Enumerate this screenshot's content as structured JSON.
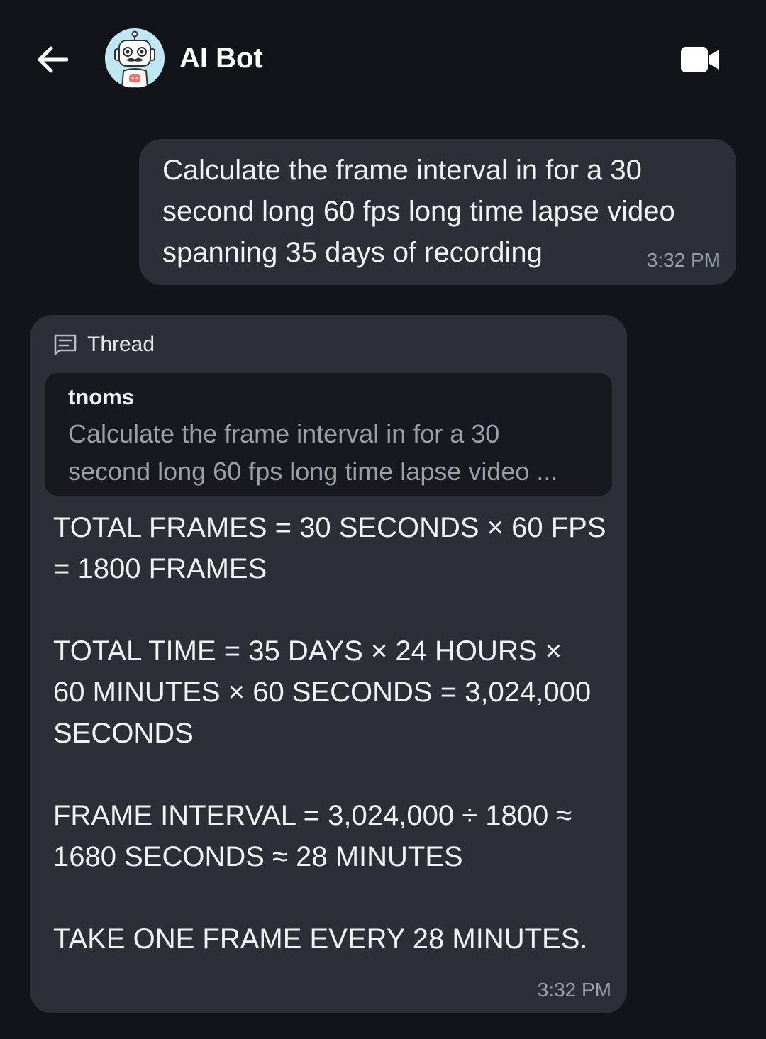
{
  "header": {
    "title": "AI Bot",
    "back_icon": "arrow-left-icon",
    "video_icon": "video-camera-icon"
  },
  "messages": {
    "user": {
      "text": "Calculate the frame interval in for a 30\nsecond long 60 fps long time lapse video\nspanning 35 days of recording",
      "time": "3:32 PM"
    },
    "bot": {
      "thread_label": "Thread",
      "quote_author": "tnoms",
      "quote_text": "Calculate the frame interval in for a 30\nsecond long 60 fps long time lapse video ...",
      "paragraphs": [
        "TOTAL FRAMES = 30 SECONDS × 60 FPS\n= 1800 FRAMES",
        " TOTAL TIME = 35 DAYS × 24 HOURS ×\n60 MINUTES × 60 SECONDS = 3,024,000\nSECONDS",
        "FRAME INTERVAL = 3,024,000 ÷ 1800 ≈\n1680 SECONDS ≈ 28 MINUTES",
        "TAKE ONE FRAME EVERY 28 MINUTES."
      ],
      "time": "3:32 PM"
    }
  },
  "colors": {
    "background": "#12141a",
    "bubble": "#2c2f36",
    "quote_bg": "#17191e",
    "avatar_bg": "#bfe6f3"
  }
}
